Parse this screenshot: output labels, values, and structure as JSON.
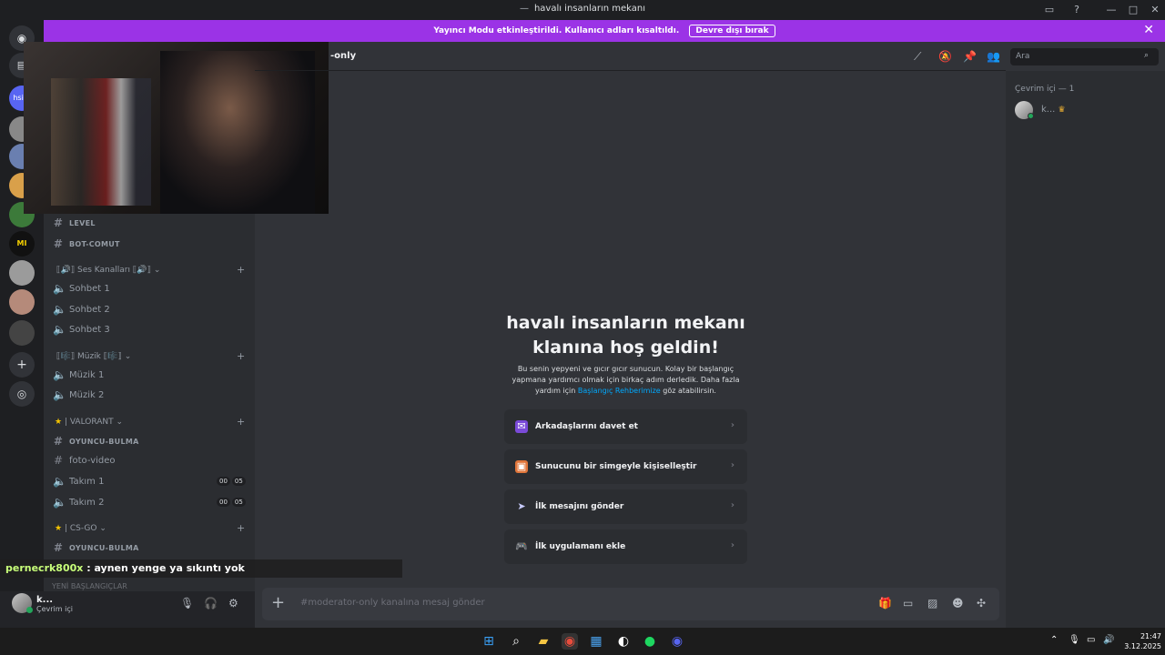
{
  "window": {
    "title": "havalı insanların mekanı"
  },
  "banner": {
    "message": "Yayıncı Modu etkinleştirildi. Kullanıcı adları kısaltıldı.",
    "button": "Devre dışı bırak"
  },
  "servers": [
    {
      "label": "hsim"
    },
    {
      "label": "MI"
    }
  ],
  "channels": {
    "text_top": [
      {
        "name": "level"
      },
      {
        "name": "bot-comut"
      }
    ],
    "voice_category": "⟦🔊⟧ Ses Kanalları ⟦🔊⟧",
    "voice": [
      {
        "name": "Sohbet 1"
      },
      {
        "name": "Sohbet 2"
      },
      {
        "name": "Sohbet 3"
      }
    ],
    "music_category": "⟦🎼⟧ Müzik ⟦🎼⟧",
    "music": [
      {
        "name": "Müzik 1"
      },
      {
        "name": "Müzik 2"
      }
    ],
    "valorant_category": "VALORANT",
    "valorant": [
      {
        "name": "oyuncu-bulma"
      },
      {
        "name": "foto-video"
      },
      {
        "name": "Takım 1",
        "count_a": "00",
        "count_b": "05"
      },
      {
        "name": "Takım 2",
        "count_a": "00",
        "count_b": "05"
      }
    ],
    "csgo_category": "CS-GO",
    "csgo": [
      {
        "name": "oyuncu-bulma"
      }
    ]
  },
  "user_panel": {
    "name": "k...",
    "status": "Çevrim içi"
  },
  "stream_overlay": {
    "nick": "pernecrk800x",
    "message": ": aynen yenge ya sıkıntı yok",
    "faded": "YENİ BAŞLANGIÇLAR"
  },
  "header": {
    "channel_suffix": "-only",
    "search_placeholder": "Ara"
  },
  "members": {
    "heading": "Çevrim içi — 1",
    "list": [
      {
        "name": "k..."
      }
    ]
  },
  "welcome": {
    "title": "havalı insanların mekanı klanına hoş geldin!",
    "desc_before": "Bu senin yepyeni ve gıcır gıcır sunucun. Kolay bir başlangıç yapmana yardımcı olmak için birkaç adım derledik. Daha fazla yardım için ",
    "desc_link": "Başlangıç Rehberimize",
    "desc_after": " göz atabilirsin.",
    "cards": [
      {
        "label": "Arkadaşlarını davet et"
      },
      {
        "label": "Sunucunu bir simgeyle kişiselleştir"
      },
      {
        "label": "İlk mesajını gönder"
      },
      {
        "label": "İlk uygulamanı ekle"
      }
    ]
  },
  "composer": {
    "placeholder": "#moderator-only kanalına mesaj gönder"
  },
  "taskbar": {
    "time": "21:47",
    "date": "3.12.2025"
  }
}
